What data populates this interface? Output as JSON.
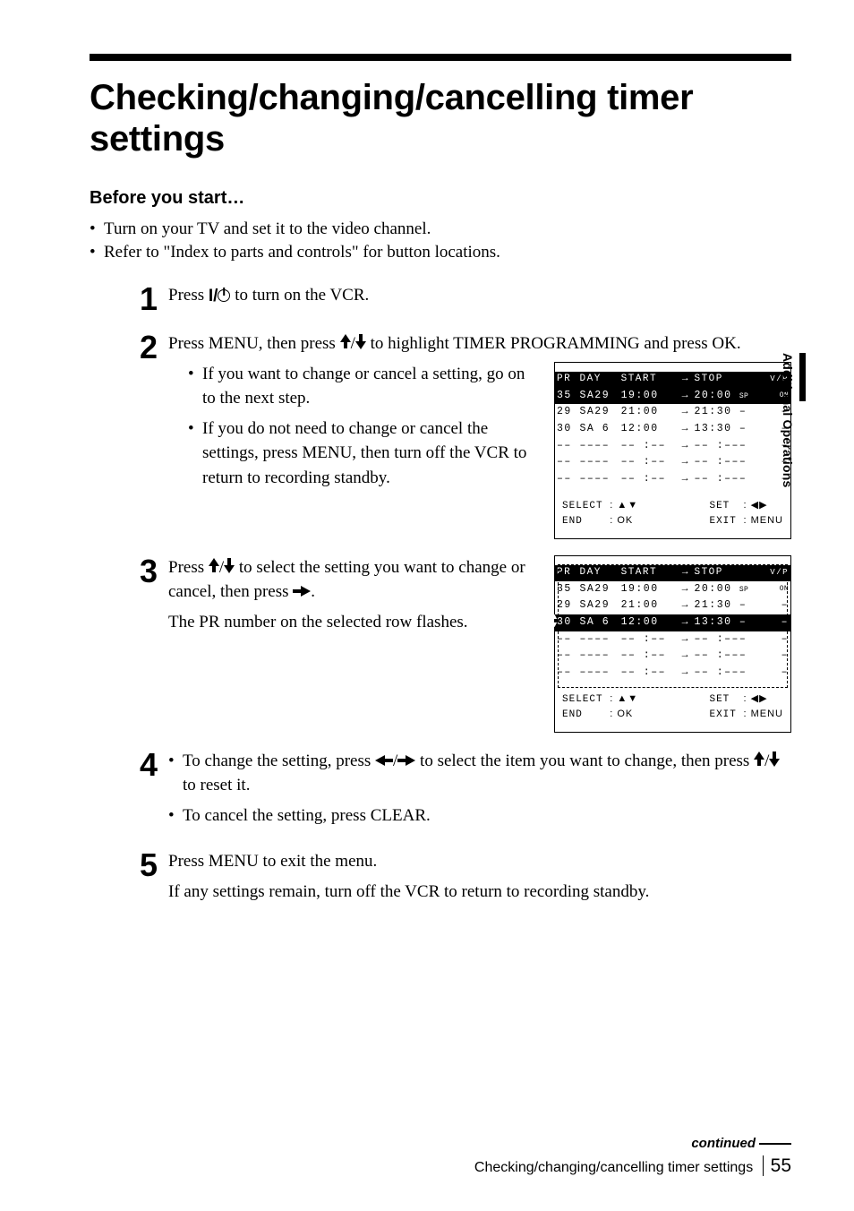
{
  "sidebar_label": "Additional Operations",
  "title": "Checking/changing/cancelling timer settings",
  "before_heading": "Before you start",
  "before_dots": "…",
  "pre_bullets": [
    "Turn on your TV and set it to the video channel.",
    "Refer to \"Index to parts and controls\" for button locations."
  ],
  "steps": {
    "s1": {
      "num": "1",
      "text_a": "Press ",
      "text_b": " to turn on the VCR.",
      "power_prefix": "I/"
    },
    "s2": {
      "num": "2",
      "line_a1": "Press MENU, then press ",
      "line_a2": " to highlight TIMER PROGRAMMING and press OK.",
      "bullets": [
        "If you want to change or cancel a setting, go on to the next step.",
        "If you do not need to change or cancel the settings, press MENU, then turn off the VCR to return to recording standby."
      ]
    },
    "s3": {
      "num": "3",
      "line_a1": "Press ",
      "line_a2": " to select the setting you want to change or cancel, then press ",
      "line_a3": ".",
      "line_b": "The PR number on the selected row flashes."
    },
    "s4": {
      "num": "4",
      "bullet1_a": "To change the setting, press ",
      "bullet1_b": " to select the item you want to change, then press ",
      "bullet1_c": " to reset it.",
      "bullet2": "To cancel the setting, press CLEAR."
    },
    "s5": {
      "num": "5",
      "line_a": "Press MENU to exit the menu.",
      "line_b": "If any settings remain, turn off the VCR to return to recording standby."
    }
  },
  "osd": {
    "head": {
      "pr": "PR",
      "day": "DAY",
      "start": "START",
      "arrow": "→",
      "stop": "STOP",
      "vp": "V/P"
    },
    "rows": [
      {
        "pr": "35",
        "day": "SA29",
        "start": "19:00",
        "stop": "20:00",
        "sp": "SP",
        "vp": "ON"
      },
      {
        "pr": "29",
        "day": "SA29",
        "start": "21:00",
        "stop": "21:30",
        "sp": "–",
        "vp": "–"
      },
      {
        "pr": "30",
        "day": "SA 6",
        "start": "12:00",
        "stop": "13:30",
        "sp": "–",
        "vp": "–"
      },
      {
        "pr": "––",
        "day": "––––",
        "start": "–– :––",
        "stop": "–– :–––",
        "sp": "",
        "vp": "–"
      },
      {
        "pr": "––",
        "day": "––––",
        "start": "–– :––",
        "stop": "–– :–––",
        "sp": "",
        "vp": "–"
      },
      {
        "pr": "––",
        "day": "––––",
        "start": "–– :––",
        "stop": "–– :–––",
        "sp": "",
        "vp": "–"
      }
    ],
    "footer": {
      "select": "SELECT",
      "select_sym": ": ▲▼",
      "end": "END",
      "end_sym": ": OK",
      "set": "SET",
      "set_sym": ": ◀▶",
      "exit": "EXIT",
      "exit_sym": ": MENU"
    }
  },
  "footer": {
    "continued": "continued",
    "title": "Checking/changing/cancelling timer settings",
    "page": "55"
  }
}
